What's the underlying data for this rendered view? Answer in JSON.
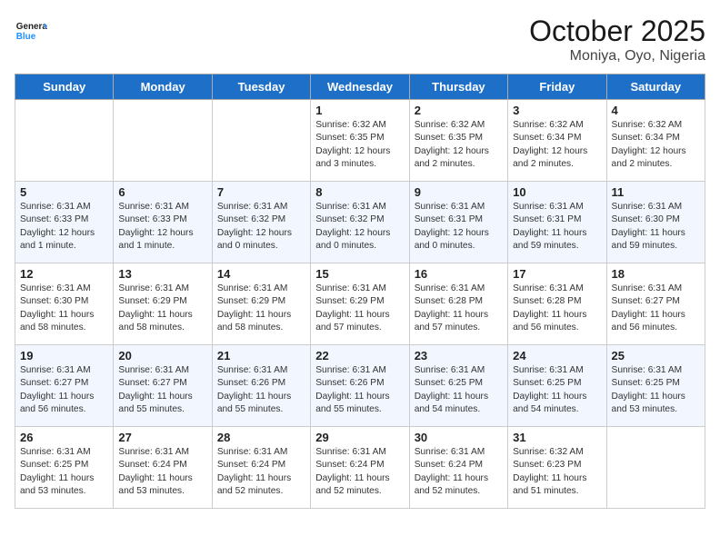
{
  "header": {
    "logo_general": "General",
    "logo_blue": "Blue",
    "month": "October 2025",
    "location": "Moniya, Oyo, Nigeria"
  },
  "days_of_week": [
    "Sunday",
    "Monday",
    "Tuesday",
    "Wednesday",
    "Thursday",
    "Friday",
    "Saturday"
  ],
  "weeks": [
    [
      {
        "day": "",
        "info": ""
      },
      {
        "day": "",
        "info": ""
      },
      {
        "day": "",
        "info": ""
      },
      {
        "day": "1",
        "info": "Sunrise: 6:32 AM\nSunset: 6:35 PM\nDaylight: 12 hours and 3 minutes."
      },
      {
        "day": "2",
        "info": "Sunrise: 6:32 AM\nSunset: 6:35 PM\nDaylight: 12 hours and 2 minutes."
      },
      {
        "day": "3",
        "info": "Sunrise: 6:32 AM\nSunset: 6:34 PM\nDaylight: 12 hours and 2 minutes."
      },
      {
        "day": "4",
        "info": "Sunrise: 6:32 AM\nSunset: 6:34 PM\nDaylight: 12 hours and 2 minutes."
      }
    ],
    [
      {
        "day": "5",
        "info": "Sunrise: 6:31 AM\nSunset: 6:33 PM\nDaylight: 12 hours and 1 minute."
      },
      {
        "day": "6",
        "info": "Sunrise: 6:31 AM\nSunset: 6:33 PM\nDaylight: 12 hours and 1 minute."
      },
      {
        "day": "7",
        "info": "Sunrise: 6:31 AM\nSunset: 6:32 PM\nDaylight: 12 hours and 0 minutes."
      },
      {
        "day": "8",
        "info": "Sunrise: 6:31 AM\nSunset: 6:32 PM\nDaylight: 12 hours and 0 minutes."
      },
      {
        "day": "9",
        "info": "Sunrise: 6:31 AM\nSunset: 6:31 PM\nDaylight: 12 hours and 0 minutes."
      },
      {
        "day": "10",
        "info": "Sunrise: 6:31 AM\nSunset: 6:31 PM\nDaylight: 11 hours and 59 minutes."
      },
      {
        "day": "11",
        "info": "Sunrise: 6:31 AM\nSunset: 6:30 PM\nDaylight: 11 hours and 59 minutes."
      }
    ],
    [
      {
        "day": "12",
        "info": "Sunrise: 6:31 AM\nSunset: 6:30 PM\nDaylight: 11 hours and 58 minutes."
      },
      {
        "day": "13",
        "info": "Sunrise: 6:31 AM\nSunset: 6:29 PM\nDaylight: 11 hours and 58 minutes."
      },
      {
        "day": "14",
        "info": "Sunrise: 6:31 AM\nSunset: 6:29 PM\nDaylight: 11 hours and 58 minutes."
      },
      {
        "day": "15",
        "info": "Sunrise: 6:31 AM\nSunset: 6:29 PM\nDaylight: 11 hours and 57 minutes."
      },
      {
        "day": "16",
        "info": "Sunrise: 6:31 AM\nSunset: 6:28 PM\nDaylight: 11 hours and 57 minutes."
      },
      {
        "day": "17",
        "info": "Sunrise: 6:31 AM\nSunset: 6:28 PM\nDaylight: 11 hours and 56 minutes."
      },
      {
        "day": "18",
        "info": "Sunrise: 6:31 AM\nSunset: 6:27 PM\nDaylight: 11 hours and 56 minutes."
      }
    ],
    [
      {
        "day": "19",
        "info": "Sunrise: 6:31 AM\nSunset: 6:27 PM\nDaylight: 11 hours and 56 minutes."
      },
      {
        "day": "20",
        "info": "Sunrise: 6:31 AM\nSunset: 6:27 PM\nDaylight: 11 hours and 55 minutes."
      },
      {
        "day": "21",
        "info": "Sunrise: 6:31 AM\nSunset: 6:26 PM\nDaylight: 11 hours and 55 minutes."
      },
      {
        "day": "22",
        "info": "Sunrise: 6:31 AM\nSunset: 6:26 PM\nDaylight: 11 hours and 55 minutes."
      },
      {
        "day": "23",
        "info": "Sunrise: 6:31 AM\nSunset: 6:25 PM\nDaylight: 11 hours and 54 minutes."
      },
      {
        "day": "24",
        "info": "Sunrise: 6:31 AM\nSunset: 6:25 PM\nDaylight: 11 hours and 54 minutes."
      },
      {
        "day": "25",
        "info": "Sunrise: 6:31 AM\nSunset: 6:25 PM\nDaylight: 11 hours and 53 minutes."
      }
    ],
    [
      {
        "day": "26",
        "info": "Sunrise: 6:31 AM\nSunset: 6:25 PM\nDaylight: 11 hours and 53 minutes."
      },
      {
        "day": "27",
        "info": "Sunrise: 6:31 AM\nSunset: 6:24 PM\nDaylight: 11 hours and 53 minutes."
      },
      {
        "day": "28",
        "info": "Sunrise: 6:31 AM\nSunset: 6:24 PM\nDaylight: 11 hours and 52 minutes."
      },
      {
        "day": "29",
        "info": "Sunrise: 6:31 AM\nSunset: 6:24 PM\nDaylight: 11 hours and 52 minutes."
      },
      {
        "day": "30",
        "info": "Sunrise: 6:31 AM\nSunset: 6:24 PM\nDaylight: 11 hours and 52 minutes."
      },
      {
        "day": "31",
        "info": "Sunrise: 6:32 AM\nSunset: 6:23 PM\nDaylight: 11 hours and 51 minutes."
      },
      {
        "day": "",
        "info": ""
      }
    ]
  ]
}
